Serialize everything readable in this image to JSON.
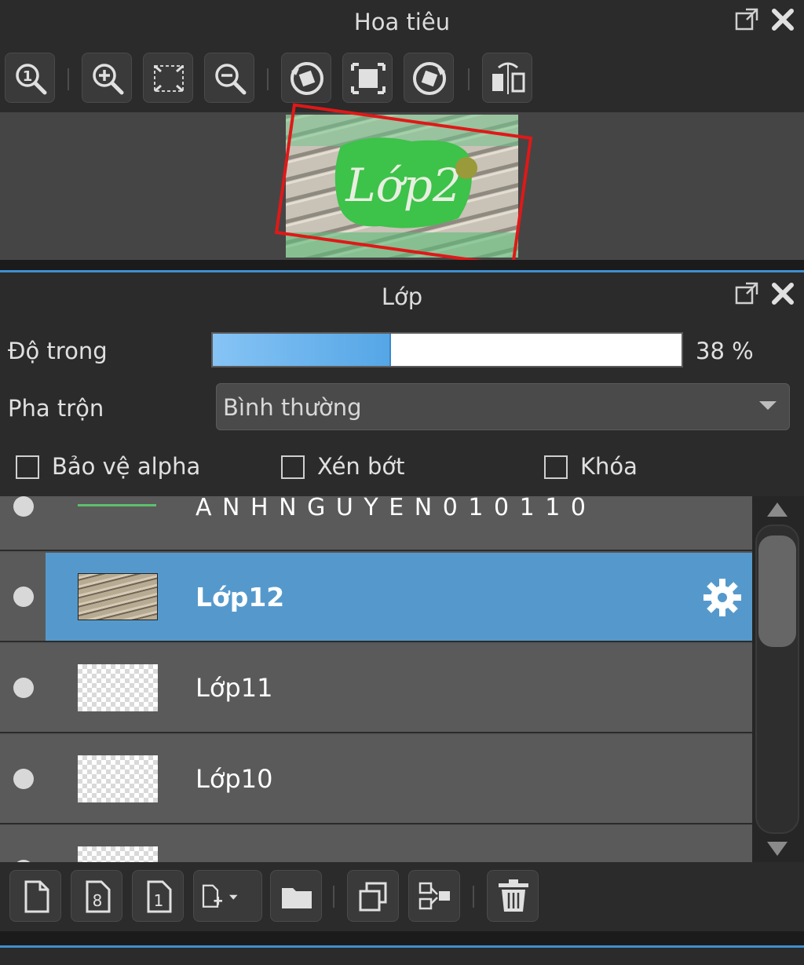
{
  "navigator": {
    "title": "Hoa tiêu",
    "toolbar_icons": [
      "zoom-actual-icon",
      "zoom-in-icon",
      "fit-window-icon",
      "zoom-out-icon",
      "rotate-left-icon",
      "reset-view-icon",
      "rotate-right-icon",
      "flip-horizontal-icon"
    ],
    "preview_text": "Lớp2"
  },
  "layers": {
    "title": "Lớp",
    "opacity_label": "Độ trong",
    "opacity_value": 38,
    "opacity_text": "38 %",
    "blend_label": "Pha trộn",
    "blend_value": "Bình thường",
    "checkboxes": [
      {
        "label": "Bảo vệ alpha",
        "checked": false
      },
      {
        "label": "Xén bớt",
        "checked": false
      },
      {
        "label": "Khóa",
        "checked": false
      }
    ],
    "items": [
      {
        "name": "A N H N G U Y E N 0 1 0 1 1 0",
        "selected": false
      },
      {
        "name": "Lớp12",
        "selected": true
      },
      {
        "name": "Lớp11",
        "selected": false
      },
      {
        "name": "Lớp10",
        "selected": false
      }
    ],
    "bottom_icons": [
      "new-layer-icon",
      "new-8bit-layer-icon",
      "new-1bit-layer-icon",
      "new-layer-menu-icon",
      "new-folder-icon",
      "duplicate-layer-icon",
      "merge-layer-icon",
      "delete-layer-icon"
    ]
  },
  "colors": {
    "accent": "#5599cc",
    "panel": "#2b2b2b",
    "nav_frame": "#e01818"
  }
}
